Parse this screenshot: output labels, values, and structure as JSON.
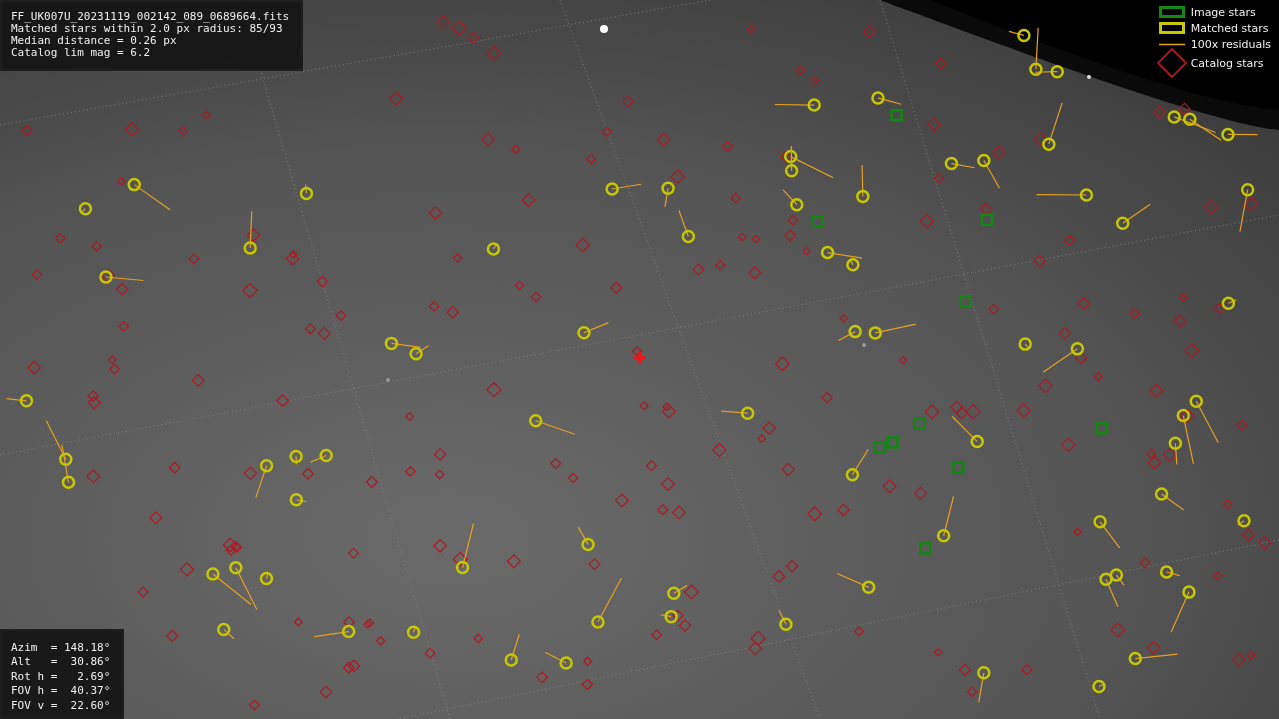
{
  "file_info": {
    "lines": [
      "FF_UK007U_20231119_002142_089_0689664.fits",
      "Matched stars within 2.0 px radius: 85/93",
      "Median distance = 0.26 px",
      "Catalog lim mag = 6.2"
    ]
  },
  "legend": [
    {
      "label": "Image stars"
    },
    {
      "kind": "matched",
      "label": "Matched stars"
    },
    {
      "kind": "residual",
      "label": "100x residuals"
    },
    {
      "kind": "catalog",
      "label": "Catalog stars"
    }
  ],
  "pointing": {
    "lines": [
      "Azim  = 148.18°",
      "Alt   =  30.86°",
      "Rot h =   2.69°",
      "FOV h =  40.37°",
      "FOV v =  22.60°"
    ]
  }
}
